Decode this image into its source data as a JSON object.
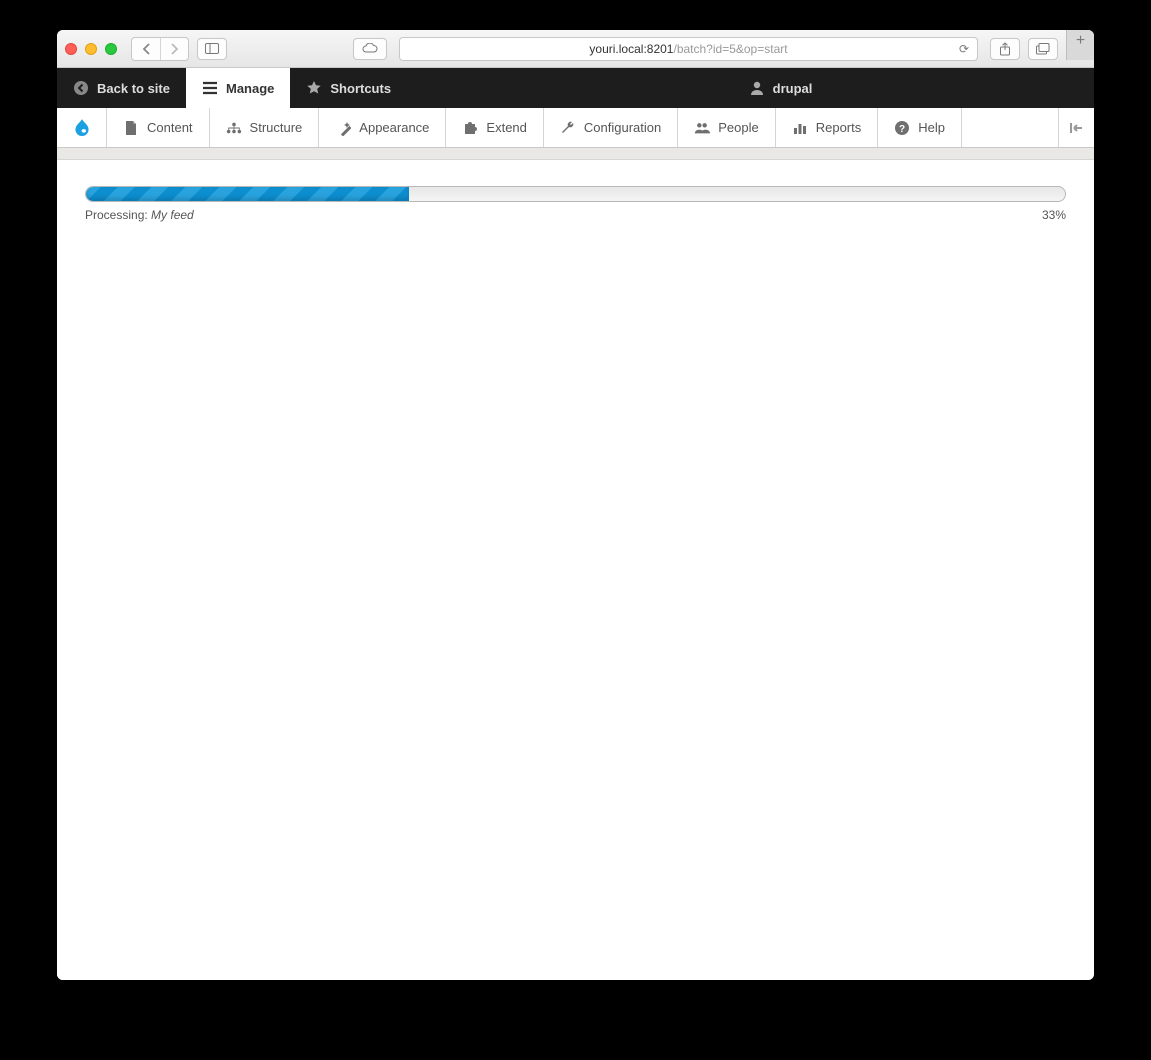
{
  "browser": {
    "url_host": "youri.local:8201",
    "url_path": "/batch?id=5&op=start"
  },
  "toolbar": {
    "back_label": "Back to site",
    "manage_label": "Manage",
    "shortcuts_label": "Shortcuts",
    "user_label": "drupal"
  },
  "menu": {
    "items": [
      {
        "label": "Content",
        "icon": "file-icon"
      },
      {
        "label": "Structure",
        "icon": "structure-icon"
      },
      {
        "label": "Appearance",
        "icon": "wand-icon"
      },
      {
        "label": "Extend",
        "icon": "puzzle-icon"
      },
      {
        "label": "Configuration",
        "icon": "wrench-icon"
      },
      {
        "label": "People",
        "icon": "people-icon"
      },
      {
        "label": "Reports",
        "icon": "bar-chart-icon"
      },
      {
        "label": "Help",
        "icon": "question-icon"
      }
    ]
  },
  "progress": {
    "label": "Processing:",
    "feed_name": "My feed",
    "percent_text": "33%",
    "percent_value": 33
  }
}
